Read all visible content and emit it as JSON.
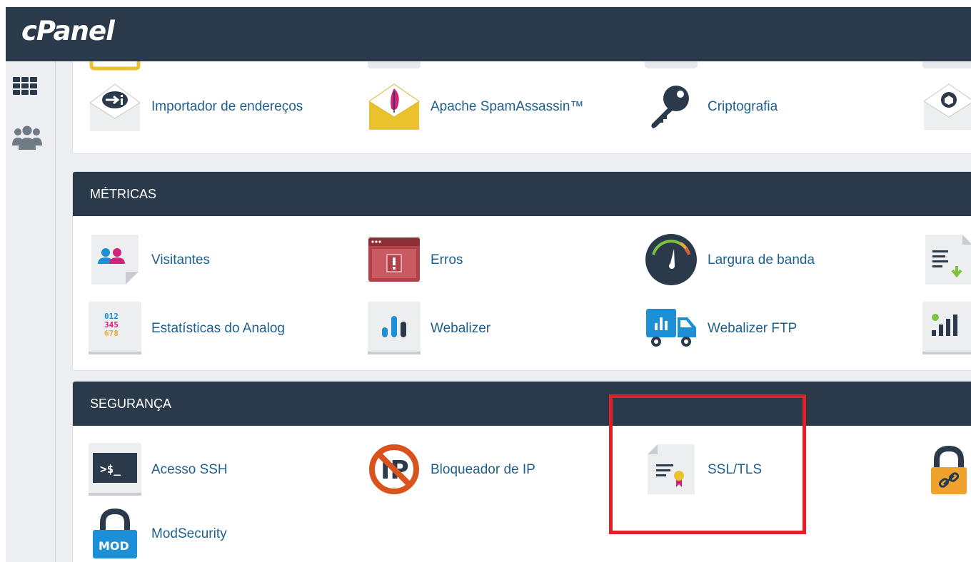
{
  "app": {
    "logo": "cPanel"
  },
  "sidebar": {
    "items": [
      {
        "icon": "grid-icon"
      },
      {
        "icon": "users-icon"
      }
    ]
  },
  "top_section": {
    "items": [
      {
        "label": "Importador de endereços",
        "icon": "import-icon"
      },
      {
        "label": "Apache SpamAssassin™",
        "icon": "spamassassin-icon"
      },
      {
        "label": "Criptografia",
        "icon": "key-icon"
      }
    ]
  },
  "metricas": {
    "title": "MÉTRICAS",
    "items": [
      {
        "label": "Visitantes",
        "icon": "visitors-icon"
      },
      {
        "label": "Erros",
        "icon": "errors-icon"
      },
      {
        "label": "Largura de banda",
        "icon": "bandwidth-gauge-icon"
      },
      {
        "label": "Estatísticas do Analog",
        "icon": "analog-stats-icon"
      },
      {
        "label": "Webalizer",
        "icon": "webalizer-icon"
      },
      {
        "label": "Webalizer FTP",
        "icon": "webalizer-ftp-icon"
      }
    ]
  },
  "seguranca": {
    "title": "SEGURANÇA",
    "items": [
      {
        "label": "Acesso SSH",
        "icon": "terminal-icon"
      },
      {
        "label": "Bloqueador de IP",
        "icon": "ip-blocker-icon"
      },
      {
        "label": "SSL/TLS",
        "icon": "certificate-icon"
      },
      {
        "label": "ModSecurity",
        "icon": "modsecurity-lock-icon"
      }
    ],
    "terminal_text": ">$_",
    "ip_text": "IP",
    "mod_text": "MOD"
  },
  "analog_digits": [
    "012",
    "345",
    "678"
  ],
  "colors": {
    "header": "#2b3a4a",
    "link": "#1f5f8d",
    "highlight": "#e3202a",
    "spam_yellow": "#e9c22e",
    "lock_blue": "#1c8fd6",
    "lock_orange": "#f0a22e"
  }
}
